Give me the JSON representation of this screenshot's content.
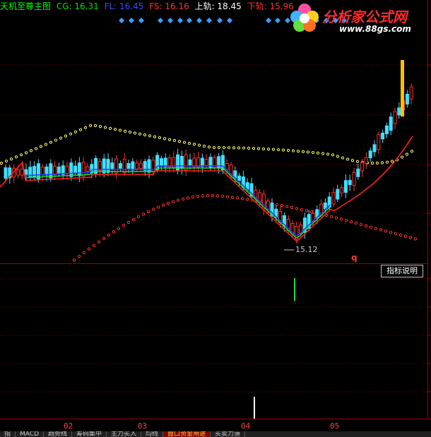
{
  "header": {
    "title": "天机至尊主图",
    "cg_label": "CG: 16.31",
    "fl_label": "FL: 16.45",
    "fs_label": "FS: 16.16",
    "upper_label": "上轨: 18.45",
    "lower_label": "下轨: 15.96",
    "colors": {
      "title": "#00ff00",
      "cg": "#00e000",
      "fl": "#3050ff",
      "fs": "#ff3030",
      "upper": "#ffffff",
      "lower": "#ff3030"
    }
  },
  "logo": {
    "site_name": "分析家公式网",
    "site_url": "www.88gs.com"
  },
  "main_chart": {
    "low_marker_label": "15.12",
    "q_label": "q"
  },
  "indicator": {
    "help_button_label": "指标说明"
  },
  "date_axis": {
    "labels": [
      "02",
      "03",
      "04",
      "05"
    ]
  },
  "tabs": [
    "指",
    "MACD",
    "趋势线",
    "筹码集中",
    "主力买入",
    "均线",
    "盘口资金用途",
    "买卖力道"
  ],
  "chart_data": {
    "type": "candlestick",
    "title": "天机至尊主图",
    "x_axis_ticks": [
      "02",
      "03",
      "04",
      "05"
    ],
    "annotations": [
      "15.12",
      "q"
    ],
    "indicator_values": {
      "CG": 16.31,
      "FL": 16.45,
      "FS": 16.16,
      "upper_band": 18.45,
      "lower_band": 15.96
    }
  }
}
